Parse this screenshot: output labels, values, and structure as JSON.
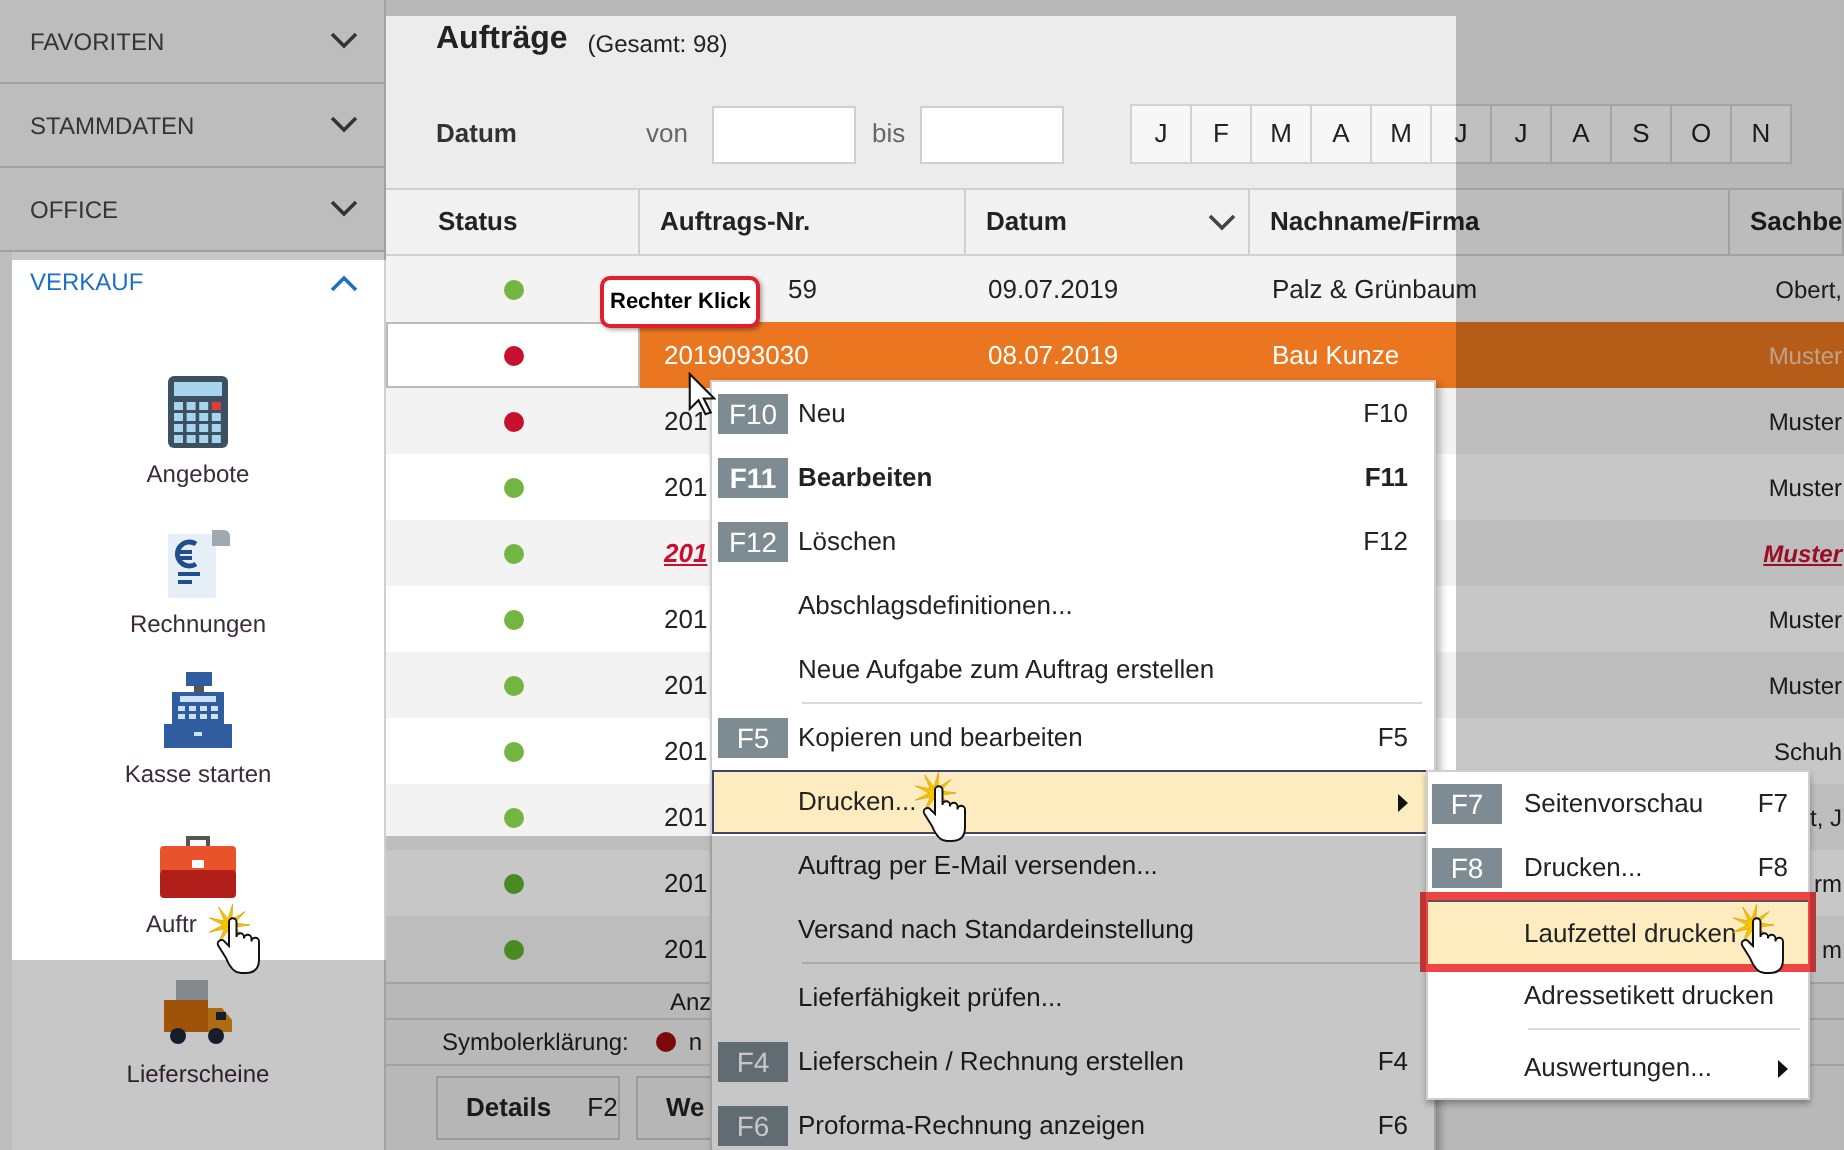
{
  "sidebar": {
    "sections": [
      {
        "label": "FAVORITEN",
        "expanded": false
      },
      {
        "label": "STAMMDATEN",
        "expanded": false
      },
      {
        "label": "OFFICE",
        "expanded": false
      },
      {
        "label": "VERKAUF",
        "expanded": true,
        "items": [
          {
            "label": "Angebote",
            "kind": "calculator",
            "cut": false
          },
          {
            "label": "Rechnungen",
            "kind": "invoice",
            "cut": false
          },
          {
            "label": "Kasse starten",
            "kind": "register",
            "cut": false
          },
          {
            "label": "Auftr",
            "kind": "briefcase",
            "cut": true
          },
          {
            "label": "Lieferscheine",
            "kind": "truck",
            "cut": false
          }
        ]
      }
    ]
  },
  "orders": {
    "title": "Aufträge",
    "total": "(Gesamt: 98)",
    "filter": {
      "label": "Datum",
      "from_label": "von",
      "to_label": "bis",
      "months": [
        "J",
        "F",
        "M",
        "A",
        "M",
        "J",
        "J",
        "A",
        "S",
        "O",
        "N"
      ]
    },
    "table": {
      "columns": [
        {
          "label": "Status",
          "sorted": false
        },
        {
          "label": "Auftrags-Nr.",
          "sorted": false
        },
        {
          "label": "Datum",
          "sorted": true
        },
        {
          "label": "Nachname/Firma",
          "sorted": false
        },
        {
          "label": "Sachbe",
          "sorted": false
        }
      ],
      "rows": [
        {
          "color": "#72b541",
          "selected": false,
          "flagged": false,
          "number": "59",
          "number_cut": true,
          "date": "09.07.2019",
          "name": "Palz & Grünbaum",
          "agent": "Obert,"
        },
        {
          "color": "#c8102e",
          "selected": true,
          "flagged": false,
          "number": "2019093030",
          "number_cut": false,
          "date": "08.07.2019",
          "name": "Bau Kunze",
          "agent": "Muster"
        },
        {
          "color": "#c8102e",
          "selected": false,
          "flagged": false,
          "number": "201",
          "number_cut": false,
          "agent": "Muster"
        },
        {
          "color": "#72b541",
          "selected": false,
          "flagged": false,
          "number": "201",
          "number_cut": false,
          "agent": "Muster"
        },
        {
          "color": "#72b541",
          "selected": false,
          "flagged": true,
          "number": "201",
          "number_cut": false,
          "agent": "Muster"
        },
        {
          "color": "#72b541",
          "selected": false,
          "flagged": false,
          "number": "201",
          "number_cut": false,
          "agent": "Muster"
        },
        {
          "color": "#72b541",
          "selected": false,
          "flagged": false,
          "number": "201",
          "number_cut": false,
          "agent": "Muster"
        },
        {
          "color": "#72b541",
          "selected": false,
          "flagged": false,
          "number": "201",
          "number_cut": false,
          "agent": "Schuh"
        },
        {
          "color": "#72b541",
          "selected": false,
          "flagged": false,
          "number": "201",
          "number_cut": false,
          "agent": "t, J"
        },
        {
          "color": "#4a8a22",
          "selected": false,
          "flagged": false,
          "number": "201",
          "number_cut": false,
          "agent": "rm"
        },
        {
          "color": "#4a8a22",
          "selected": false,
          "flagged": false,
          "number": "201",
          "number_cut": false,
          "agent": "m"
        }
      ]
    },
    "count_label": "Anz",
    "legend": {
      "label": "Symbolerklärung:",
      "items": [
        {
          "color": "#7a0a0a",
          "text": "n"
        }
      ]
    },
    "buttons": [
      {
        "label": "Details",
        "shortcut": "F2"
      },
      {
        "label": "We"
      }
    ]
  },
  "tooltip": {
    "text": "Rechter Klick"
  },
  "context_menu": {
    "items": [
      {
        "kind": "item",
        "key": "F10",
        "label": "Neu",
        "shortcut": "F10",
        "bold": false,
        "highlighted": false,
        "has_submenu": false
      },
      {
        "kind": "item",
        "key": "F11",
        "label": "Bearbeiten",
        "shortcut": "F11",
        "bold": true,
        "highlighted": false,
        "has_submenu": false
      },
      {
        "kind": "item",
        "key": "F12",
        "label": "Löschen",
        "shortcut": "F12",
        "bold": false,
        "highlighted": false,
        "has_submenu": false
      },
      {
        "kind": "item",
        "label": "Abschlagsdefinitionen...",
        "bold": false,
        "highlighted": false,
        "has_submenu": false
      },
      {
        "kind": "item",
        "label": "Neue Aufgabe zum Auftrag erstellen",
        "bold": false,
        "highlighted": false,
        "has_submenu": false
      },
      {
        "kind": "separator"
      },
      {
        "kind": "item",
        "key": "F5",
        "label": "Kopieren und bearbeiten",
        "shortcut": "F5",
        "bold": false,
        "highlighted": false,
        "has_submenu": false
      },
      {
        "kind": "item",
        "label": "Drucken...",
        "bold": false,
        "highlighted": true,
        "has_submenu": true,
        "children": [
          {
            "kind": "item",
            "key": "F7",
            "label": "Seitenvorschau",
            "shortcut": "F7",
            "highlighted": false,
            "framed": false,
            "has_submenu": false
          },
          {
            "kind": "item",
            "key": "F8",
            "label": "Drucken...",
            "shortcut": "F8",
            "highlighted": false,
            "framed": false,
            "has_submenu": false
          },
          {
            "kind": "item",
            "label": "Laufzettel drucken",
            "highlighted": true,
            "framed": true,
            "has_submenu": false
          },
          {
            "kind": "item",
            "label": "Adressetikett drucken",
            "highlighted": false,
            "framed": false,
            "has_submenu": false
          },
          {
            "kind": "separator"
          },
          {
            "kind": "item",
            "label": "Auswertungen...",
            "highlighted": false,
            "framed": false,
            "has_submenu": true
          }
        ]
      },
      {
        "kind": "item",
        "label": "Auftrag per E-Mail versenden...",
        "bold": false,
        "highlighted": false,
        "has_submenu": false
      },
      {
        "kind": "item",
        "label": "Versand nach Standardeinstellung",
        "bold": false,
        "highlighted": false,
        "has_submenu": false
      },
      {
        "kind": "separator"
      },
      {
        "kind": "item",
        "label": "Lieferfähigkeit prüfen...",
        "bold": false,
        "highlighted": false,
        "has_submenu": false
      },
      {
        "kind": "item",
        "key": "F4",
        "label": "Lieferschein / Rechnung erstellen",
        "shortcut": "F4",
        "bold": false,
        "highlighted": false,
        "has_submenu": false
      },
      {
        "kind": "item",
        "key": "F6",
        "label": "Proforma-Rechnung anzeigen",
        "shortcut": "F6",
        "bold": false,
        "highlighted": false,
        "has_submenu": false
      }
    ]
  }
}
